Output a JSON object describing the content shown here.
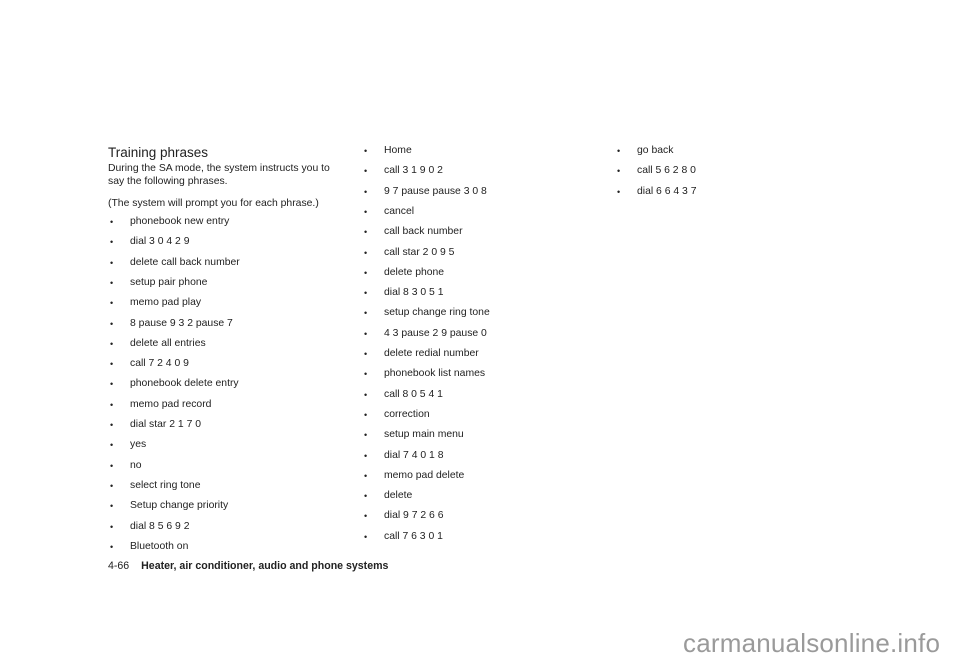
{
  "section": {
    "title": "Training phrases",
    "intro": "During the SA mode, the system instructs you to say the following phrases.",
    "note": "(The system will prompt you for each phrase.)"
  },
  "bullet_glyph": "•",
  "columns": [
    {
      "items": [
        "phonebook new entry",
        "dial 3 0 4 2 9",
        "delete call back number",
        "setup pair phone",
        "memo pad play",
        "8 pause 9 3 2 pause 7",
        "delete all entries",
        "call 7 2 4 0 9",
        "phonebook delete entry",
        "memo pad record",
        "dial star 2 1 7 0",
        "yes",
        "no",
        "select ring tone",
        "Setup change priority",
        "dial 8 5 6 9 2",
        "Bluetooth on"
      ]
    },
    {
      "items": [
        "Home",
        "call 3 1 9 0 2",
        "9 7 pause pause 3 0 8",
        "cancel",
        "call back number",
        "call star 2 0 9 5",
        "delete phone",
        "dial 8 3 0 5 1",
        "setup change ring tone",
        "4 3 pause 2 9 pause 0",
        "delete redial number",
        "phonebook list names",
        "call 8 0 5 4 1",
        "correction",
        "setup main menu",
        "dial 7 4 0 1 8",
        "memo pad delete",
        "delete",
        "dial 9 7 2 6 6",
        "call 7 6 3 0 1"
      ]
    },
    {
      "items": [
        "go back",
        "call 5 6 2 8 0",
        "dial 6 6 4 3 7"
      ]
    }
  ],
  "footer": {
    "page_number": "4-66",
    "section_title": "Heater, air conditioner, audio and phone systems"
  },
  "watermark": "carmanualsonline.info"
}
